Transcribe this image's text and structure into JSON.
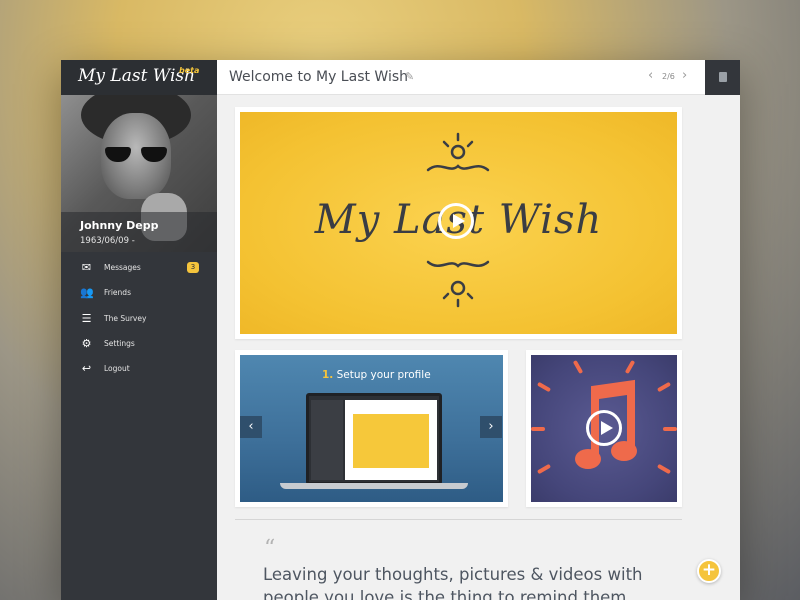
{
  "app": {
    "logo": "My Last Wish",
    "badge": "beta"
  },
  "profile": {
    "name": "Johnny Depp",
    "birth": "1963/06/09 -"
  },
  "sidebar": {
    "items": [
      {
        "label": "Messages",
        "icon": "envelope-icon",
        "badge": "3"
      },
      {
        "label": "Friends",
        "icon": "users-icon"
      },
      {
        "label": "The Survey",
        "icon": "list-icon"
      },
      {
        "label": "Settings",
        "icon": "gear-icon"
      },
      {
        "label": "Logout",
        "icon": "reply-icon"
      }
    ]
  },
  "header": {
    "title": "Welcome to My Last Wish",
    "pager": "2/6"
  },
  "hero": {
    "wordmark": "My Last Wish"
  },
  "slider": {
    "step": "1.",
    "heading": "Setup your profile"
  },
  "quote": {
    "text": "Leaving your thoughts, pictures & videos with people you love is the thing to remind them"
  },
  "colors": {
    "accent": "#f5c43c",
    "sidebar": "#33363b",
    "hero": "#f4c232"
  }
}
